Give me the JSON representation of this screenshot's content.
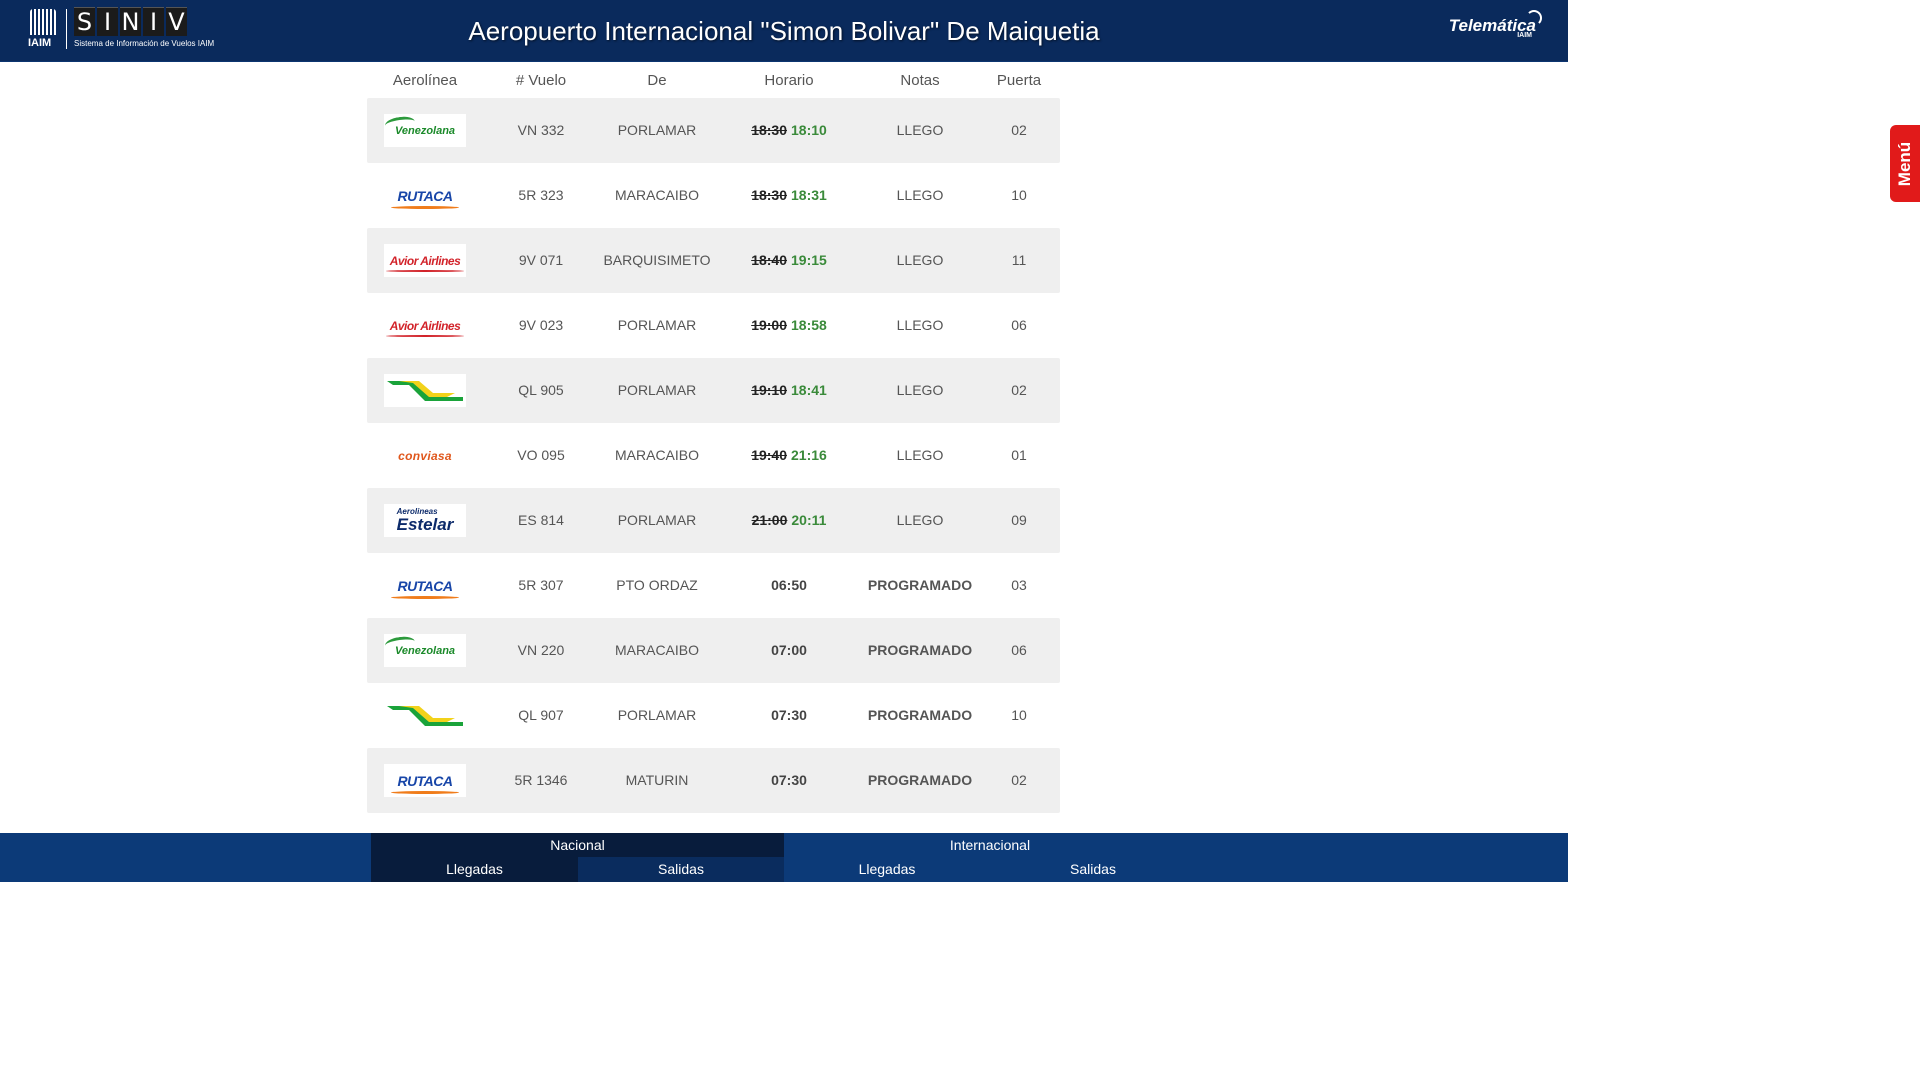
{
  "header": {
    "title": "Aeropuerto Internacional \"Simon Bolivar\" De Maiquetia",
    "logo_left_iaim": "IAIM",
    "logo_left_siniv": [
      "S",
      "I",
      "N",
      "I",
      "V"
    ],
    "logo_left_subtitle": "Sistema de Información de Vuelos IAIM",
    "logo_right": "Telemática",
    "logo_right_sub": "IAIM"
  },
  "table": {
    "headers": [
      "Aerolínea",
      "# Vuelo",
      "De",
      "Horario",
      "Notas",
      "Puerta"
    ],
    "rows": [
      {
        "airline": "venezolana",
        "airline_text": "Venezolana",
        "flight": "VN 332",
        "from": "PORLAMAR",
        "time_sched": "18:30",
        "time_new": "18:10",
        "status": "LLEGO",
        "gate": "02"
      },
      {
        "airline": "rutaca",
        "airline_text": "RUTACA",
        "flight": "5R 323",
        "from": "MARACAIBO",
        "time_sched": "18:30",
        "time_new": "18:31",
        "status": "LLEGO",
        "gate": "10"
      },
      {
        "airline": "avior",
        "airline_text": "Avior Airlines",
        "flight": "9V 071",
        "from": "BARQUISIMETO",
        "time_sched": "18:40",
        "time_new": "19:15",
        "status": "LLEGO",
        "gate": "11"
      },
      {
        "airline": "avior",
        "airline_text": "Avior Airlines",
        "flight": "9V 023",
        "from": "PORLAMAR",
        "time_sched": "19:00",
        "time_new": "18:58",
        "status": "LLEGO",
        "gate": "06"
      },
      {
        "airline": "laser",
        "airline_text": "",
        "flight": "QL 905",
        "from": "PORLAMAR",
        "time_sched": "19:10",
        "time_new": "18:41",
        "status": "LLEGO",
        "gate": "02"
      },
      {
        "airline": "conviasa",
        "airline_text": "conviasa",
        "flight": "VO 095",
        "from": "MARACAIBO",
        "time_sched": "19:40",
        "time_new": "21:16",
        "status": "LLEGO",
        "gate": "01"
      },
      {
        "airline": "estelar",
        "airline_text": "Estelar",
        "airline_text_small": "Aerolineas",
        "flight": "ES 814",
        "from": "PORLAMAR",
        "time_sched": "21:00",
        "time_new": "20:11",
        "status": "LLEGO",
        "gate": "09"
      },
      {
        "airline": "rutaca",
        "airline_text": "RUTACA",
        "flight": "5R 307",
        "from": "PTO ORDAZ",
        "time_sched": "06:50",
        "time_new": "",
        "status": "PROGRAMADO",
        "gate": "03"
      },
      {
        "airline": "venezolana",
        "airline_text": "Venezolana",
        "flight": "VN 220",
        "from": "MARACAIBO",
        "time_sched": "07:00",
        "time_new": "",
        "status": "PROGRAMADO",
        "gate": "06"
      },
      {
        "airline": "laser",
        "airline_text": "",
        "flight": "QL 907",
        "from": "PORLAMAR",
        "time_sched": "07:30",
        "time_new": "",
        "status": "PROGRAMADO",
        "gate": "10"
      },
      {
        "airline": "rutaca",
        "airline_text": "RUTACA",
        "flight": "5R 1346",
        "from": "MATURIN",
        "time_sched": "07:30",
        "time_new": "",
        "status": "PROGRAMADO",
        "gate": "02"
      }
    ]
  },
  "side_menu": {
    "label": "Menú"
  },
  "footer": {
    "nacional": "Nacional",
    "internacional": "Internacional",
    "nacional_llegadas": "Llegadas",
    "nacional_salidas": "Salidas",
    "internacional_llegadas": "Llegadas",
    "internacional_salidas": "Salidas"
  },
  "colors": {
    "header_bg": "#0a2a5c",
    "row_shade": "#efefef",
    "arrived": "#3f9a3f",
    "menu_tab": "#e11a1a",
    "footer_bg": "#0c3a78",
    "footer_active": "#081c3c"
  }
}
